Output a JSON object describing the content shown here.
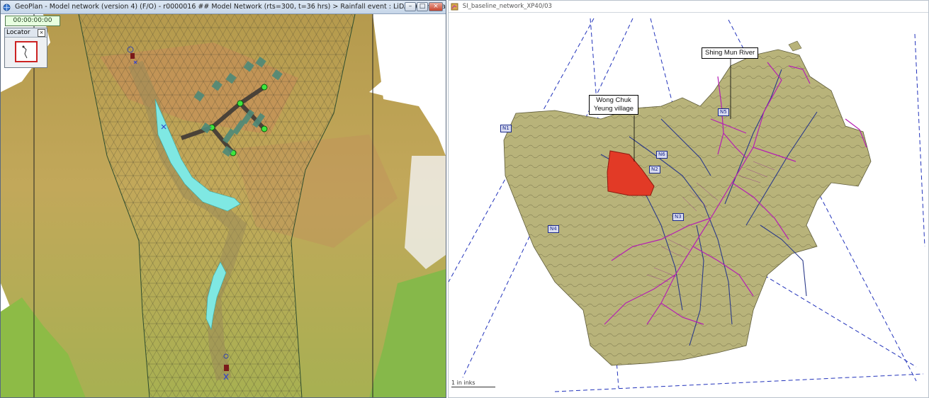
{
  "left_window": {
    "title": "GeoPlan - Model network (version 4) (F/O) - r0000016 ## Model Network (rts=300, t=36 hrs) > Rainfall event : LiDAR (mm) [Target]",
    "time": "00:00:00:00",
    "locator_title": "Locator"
  },
  "right_window": {
    "title": "SI_baseline_network_XP40/03"
  },
  "labels": {
    "river": "Shing Mun River",
    "village_line1": "Wong Chuk",
    "village_line2": "Yeung village"
  },
  "node_tags": [
    "N1",
    "N2",
    "N3",
    "N4",
    "N5",
    "N6"
  ],
  "scale_text": "1 in   inks",
  "colors": {
    "terrain": "#b7a256",
    "highlight": "#e23a26",
    "water": "#7fe8e3",
    "catchment": "#b8b37a",
    "network": "#b51fb3"
  }
}
